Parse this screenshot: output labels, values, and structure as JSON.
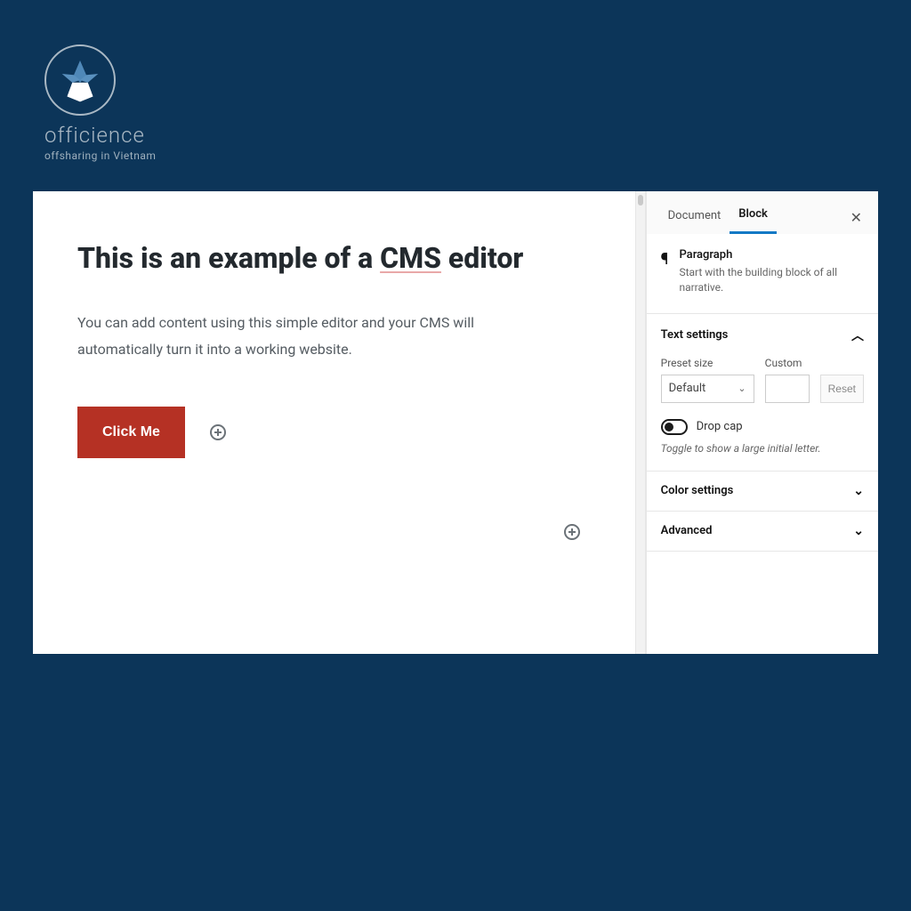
{
  "brand": {
    "name": "officience",
    "tagline": "offsharing in Vietnam"
  },
  "editor": {
    "heading_pre": "This is an example of a ",
    "heading_underlined": "CMS",
    "heading_post": " editor",
    "body": "You can add content using this simple editor and your CMS will automatically turn it into a working website.",
    "cta_label": "Click Me"
  },
  "sidebar": {
    "tabs": {
      "document": "Document",
      "block": "Block"
    },
    "block_type": {
      "title": "Paragraph",
      "desc": "Start with the building block of all narrative."
    },
    "text_settings": {
      "title": "Text settings",
      "preset_label": "Preset size",
      "preset_value": "Default",
      "custom_label": "Custom",
      "reset": "Reset",
      "dropcap_label": "Drop cap",
      "dropcap_hint": "Toggle to show a large initial letter."
    },
    "color_settings": {
      "title": "Color settings"
    },
    "advanced": {
      "title": "Advanced"
    }
  }
}
